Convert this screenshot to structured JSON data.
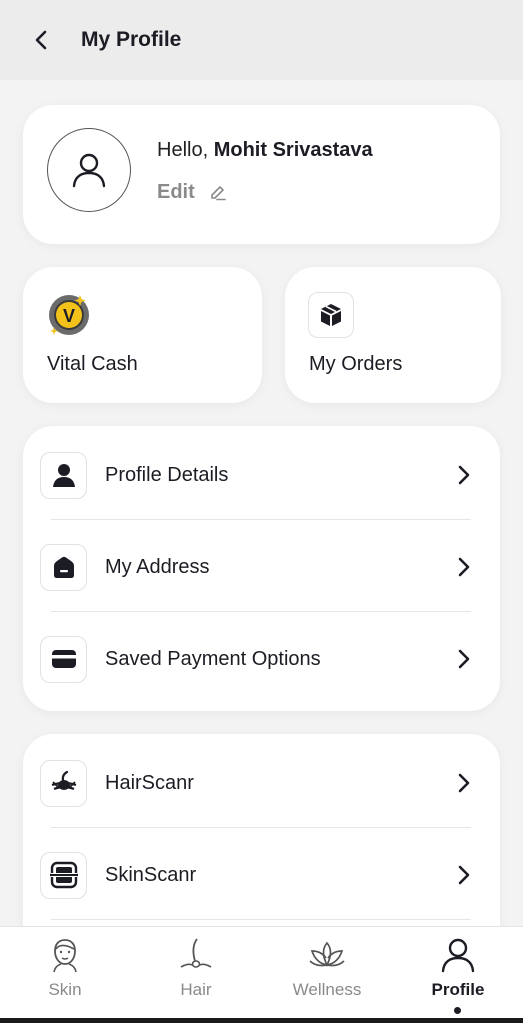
{
  "header": {
    "title": "My Profile",
    "back_icon": "chevron-left-icon"
  },
  "profile": {
    "greeting": "Hello,",
    "name": "Mohit Srivastava",
    "edit_label": "Edit",
    "avatar_icon": "user-icon",
    "edit_icon": "pencil-icon"
  },
  "tiles": [
    {
      "label": "Vital Cash",
      "icon": "vital-cash-coin-icon"
    },
    {
      "label": "My Orders",
      "icon": "box-icon"
    }
  ],
  "account_list": [
    {
      "label": "Profile Details",
      "icon": "user-icon"
    },
    {
      "label": "My Address",
      "icon": "home-icon"
    },
    {
      "label": "Saved Payment Options",
      "icon": "card-icon"
    }
  ],
  "tools_list": [
    {
      "label": "HairScanr",
      "icon": "hair-scan-icon"
    },
    {
      "label": "SkinScanr",
      "icon": "skin-scan-icon"
    }
  ],
  "bottom_nav": [
    {
      "label": "Skin",
      "icon": "face-icon",
      "active": false
    },
    {
      "label": "Hair",
      "icon": "hair-icon",
      "active": false
    },
    {
      "label": "Wellness",
      "icon": "lotus-icon",
      "active": false
    },
    {
      "label": "Profile",
      "icon": "user-icon",
      "active": true
    }
  ],
  "colors": {
    "background": "#f3f3f3",
    "card": "#ffffff",
    "text": "#1c1c24",
    "muted": "#8a8a8a",
    "coin_gold": "#f2c21b"
  }
}
